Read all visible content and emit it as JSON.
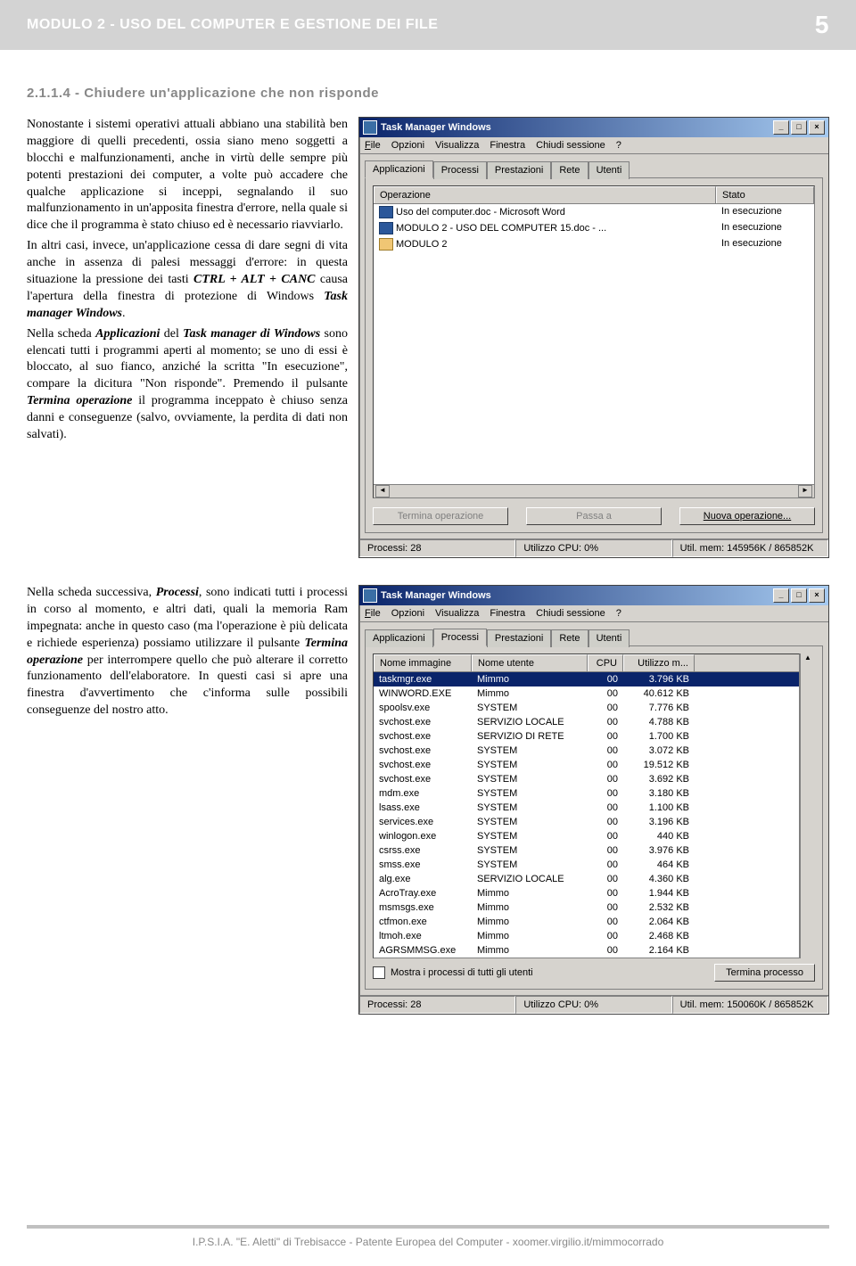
{
  "header": {
    "title": "MODULO 2 - USO DEL COMPUTER E GESTIONE DEI FILE",
    "page_number": "5"
  },
  "section": {
    "heading": "2.1.1.4 - Chiudere un'applicazione che non risponde"
  },
  "para1": "Nonostante i sistemi operativi attuali abbiano una stabilità ben maggiore di quelli precedenti, ossia siano meno soggetti a blocchi e malfunzionamenti, anche in virtù delle sempre più potenti prestazioni dei computer, a volte può accadere che qualche applicazione si inceppi, segnalando il suo malfunzionamento in un'apposita finestra d'errore, nella quale si dice che il programma è stato chiuso ed è necessario riavviarlo.",
  "para2": "In altri casi, invece, un'applicazione cessa di dare segni di vita anche in assenza di palesi messaggi d'errore: in questa situazione la pressione dei tasti CTRL + ALT + CANC causa l'apertura della finestra di protezione di Windows Task manager Windows.",
  "para3": "Nella scheda Applicazioni del Task manager di Windows sono elencati tutti i programmi aperti al momento; se uno di essi è bloccato, al suo fianco, anziché la scritta \"In esecuzione\", compare la dicitura \"Non risponde\". Premendo il pulsante Termina operazione il programma inceppato è chiuso senza danni e conseguenze (salvo, ovviamente, la perdita di dati non salvati).",
  "para4": "Nella scheda successiva, Processi, sono indicati tutti i processi in corso al momento, e altri dati, quali la memoria Ram impegnata: anche in questo caso (ma l'operazione è più delicata e richiede esperienza) possiamo utilizzare il pulsante Termina operazione per interrompere quello che può alterare il corretto funzionamento dell'elaboratore. In questi casi si apre una finestra d'avvertimento che c'informa sulle possibili conseguenze del nostro atto.",
  "tm": {
    "title": "Task Manager Windows",
    "menu": {
      "file": "File",
      "opzioni": "Opzioni",
      "visualizza": "Visualizza",
      "finestra": "Finestra",
      "chiudi": "Chiudi sessione",
      "help": "?"
    },
    "tabs": {
      "applicazioni": "Applicazioni",
      "processi": "Processi",
      "prestazioni": "Prestazioni",
      "rete": "Rete",
      "utenti": "Utenti"
    },
    "apps": {
      "col_op": "Operazione",
      "col_stato": "Stato",
      "rows": [
        {
          "name": "Uso del computer.doc - Microsoft Word",
          "status": "In esecuzione",
          "icon": "word"
        },
        {
          "name": "MODULO 2 - USO DEL COMPUTER 15.doc - ...",
          "status": "In esecuzione",
          "icon": "word"
        },
        {
          "name": "MODULO 2",
          "status": "In esecuzione",
          "icon": "folder"
        }
      ],
      "btn_termina": "Termina operazione",
      "btn_passa": "Passa a",
      "btn_nuova": "Nuova operazione..."
    },
    "status1": {
      "proc": "Processi: 28",
      "cpu": "Utilizzo CPU: 0%",
      "mem": "Util. mem: 145956K / 865852K"
    },
    "procs": {
      "col_img": "Nome immagine",
      "col_user": "Nome utente",
      "col_cpu": "CPU",
      "col_mem": "Utilizzo m...",
      "rows": [
        {
          "n": "taskmgr.exe",
          "u": "Mimmo",
          "c": "00",
          "m": "3.796 KB",
          "sel": true
        },
        {
          "n": "WINWORD.EXE",
          "u": "Mimmo",
          "c": "00",
          "m": "40.612 KB"
        },
        {
          "n": "spoolsv.exe",
          "u": "SYSTEM",
          "c": "00",
          "m": "7.776 KB"
        },
        {
          "n": "svchost.exe",
          "u": "SERVIZIO LOCALE",
          "c": "00",
          "m": "4.788 KB"
        },
        {
          "n": "svchost.exe",
          "u": "SERVIZIO DI RETE",
          "c": "00",
          "m": "1.700 KB"
        },
        {
          "n": "svchost.exe",
          "u": "SYSTEM",
          "c": "00",
          "m": "3.072 KB"
        },
        {
          "n": "svchost.exe",
          "u": "SYSTEM",
          "c": "00",
          "m": "19.512 KB"
        },
        {
          "n": "svchost.exe",
          "u": "SYSTEM",
          "c": "00",
          "m": "3.692 KB"
        },
        {
          "n": "mdm.exe",
          "u": "SYSTEM",
          "c": "00",
          "m": "3.180 KB"
        },
        {
          "n": "lsass.exe",
          "u": "SYSTEM",
          "c": "00",
          "m": "1.100 KB"
        },
        {
          "n": "services.exe",
          "u": "SYSTEM",
          "c": "00",
          "m": "3.196 KB"
        },
        {
          "n": "winlogon.exe",
          "u": "SYSTEM",
          "c": "00",
          "m": "440 KB"
        },
        {
          "n": "csrss.exe",
          "u": "SYSTEM",
          "c": "00",
          "m": "3.976 KB"
        },
        {
          "n": "smss.exe",
          "u": "SYSTEM",
          "c": "00",
          "m": "464 KB"
        },
        {
          "n": "alg.exe",
          "u": "SERVIZIO LOCALE",
          "c": "00",
          "m": "4.360 KB"
        },
        {
          "n": "AcroTray.exe",
          "u": "Mimmo",
          "c": "00",
          "m": "1.944 KB"
        },
        {
          "n": "msmsgs.exe",
          "u": "Mimmo",
          "c": "00",
          "m": "2.532 KB"
        },
        {
          "n": "ctfmon.exe",
          "u": "Mimmo",
          "c": "00",
          "m": "2.064 KB"
        },
        {
          "n": "ltmoh.exe",
          "u": "Mimmo",
          "c": "00",
          "m": "2.468 KB"
        },
        {
          "n": "AGRSMMSG.exe",
          "u": "Mimmo",
          "c": "00",
          "m": "2.164 KB"
        }
      ],
      "show_all": "Mostra i processi di tutti gli utenti",
      "btn_termina": "Termina processo"
    },
    "status2": {
      "proc": "Processi: 28",
      "cpu": "Utilizzo CPU: 0%",
      "mem": "Util. mem: 150060K / 865852K"
    }
  },
  "footer": "I.P.S.I.A. \"E. Aletti\" di Trebisacce  -  Patente Europea del Computer  -  xoomer.virgilio.it/mimmocorrado"
}
